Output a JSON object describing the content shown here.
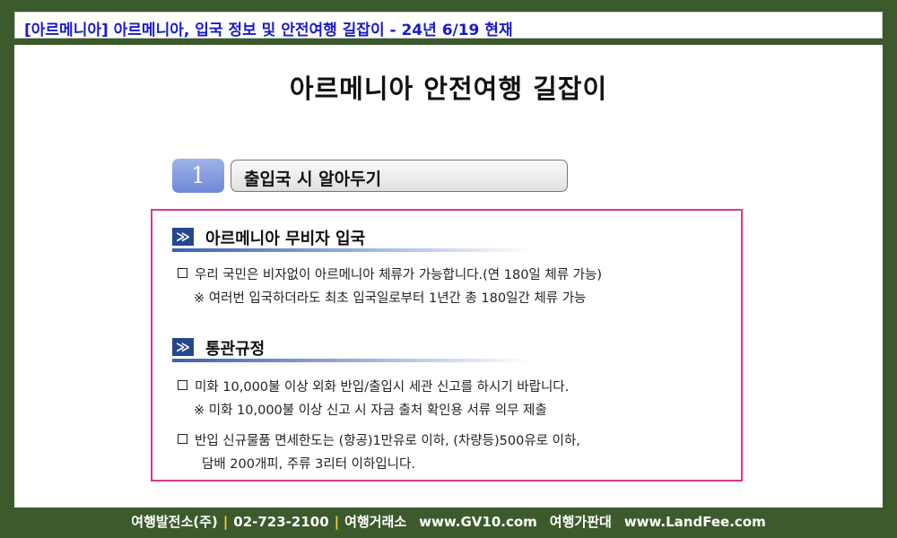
{
  "header": {
    "title": "[아르메니아] 아르메니아, 입국 정보 및 안전여행 길잡이 - 24년 6/19 현재"
  },
  "document": {
    "main_title": "아르메니아 안전여행 길잡이",
    "section": {
      "number": "1",
      "title": "출입국 시 알아두기"
    },
    "subsections": [
      {
        "heading": "아르메니아 무비자 입국",
        "icon": "double-chevron-icon",
        "lines": [
          "우리 국민은 비자없이 아르메니아 체류가 가능합니다.(연 180일 체류 가능)",
          "※ 여러번 입국하더라도 최초 입국일로부터 1년간 총 180일간 체류 가능"
        ]
      },
      {
        "heading": "통관규정",
        "icon": "double-chevron-icon",
        "lines": [
          "미화 10,000불 이상 외화 반입/출입시 세관 신고를 하시기 바랍니다.",
          "※ 미화 10,000불 이상 신고 시 자금 출처 확인용 서류 의무 제출",
          "반입 신규물품 면세한도는 (항공)1만유로 이하, (차량등)500유로 이하,",
          "담배 200개피, 주류 3리터 이하입니다."
        ]
      }
    ]
  },
  "footer": {
    "company": "여행발전소(주)",
    "phone": "02-723-2100",
    "site1_name": "여행거래소",
    "site1_url": "www.GV10.com",
    "site2_name": "여행가판대",
    "site2_url": "www.LandFee.com"
  },
  "colors": {
    "background": "#3d5a2c",
    "header_text": "#1a1acc",
    "box_border": "#e0368e",
    "heading_icon": "#25478f",
    "footer_separator": "#f2d33a"
  }
}
